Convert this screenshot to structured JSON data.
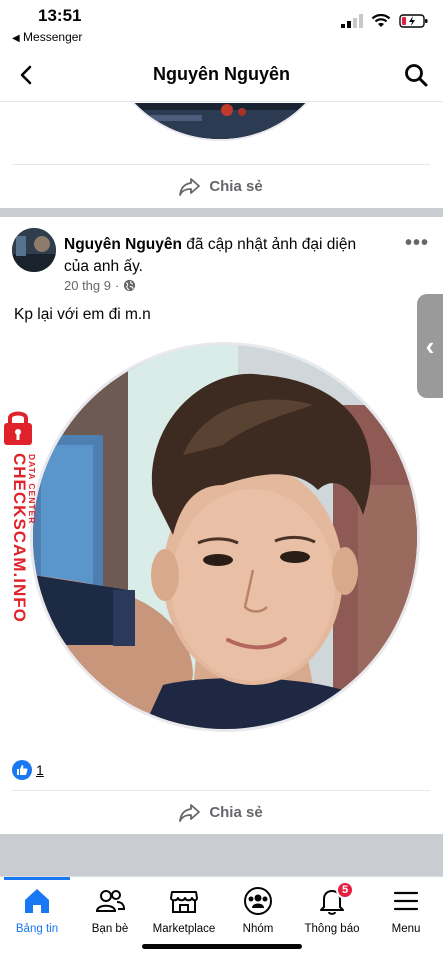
{
  "status_bar": {
    "time": "13:51",
    "back_app": "Messenger"
  },
  "header": {
    "title": "Nguyên Nguyên"
  },
  "previous_post": {
    "share_label": "Chia sẻ"
  },
  "post": {
    "author": "Nguyên Nguyên",
    "action": "đã cập nhật ảnh đại diện của anh ấy.",
    "date": "20 thg 9",
    "visibility_icon": "globe-icon",
    "caption": "Kp lại với em đi m.n",
    "like_count": "1",
    "share_label": "Chia sẻ"
  },
  "watermark": {
    "line1": "CHECKSCAM.INFO",
    "line2": "DATA CENTER"
  },
  "tabbar": {
    "items": [
      {
        "label": "Bảng tin",
        "icon": "home-icon",
        "active": true
      },
      {
        "label": "Bạn bè",
        "icon": "friends-icon"
      },
      {
        "label": "Marketplace",
        "icon": "store-icon"
      },
      {
        "label": "Nhóm",
        "icon": "groups-icon"
      },
      {
        "label": "Thông báo",
        "icon": "bell-icon",
        "badge": "5"
      },
      {
        "label": "Menu",
        "icon": "menu-icon"
      }
    ]
  },
  "colors": {
    "accent": "#1877f2",
    "badge": "#e41e3f",
    "watermark": "#e0222b"
  }
}
